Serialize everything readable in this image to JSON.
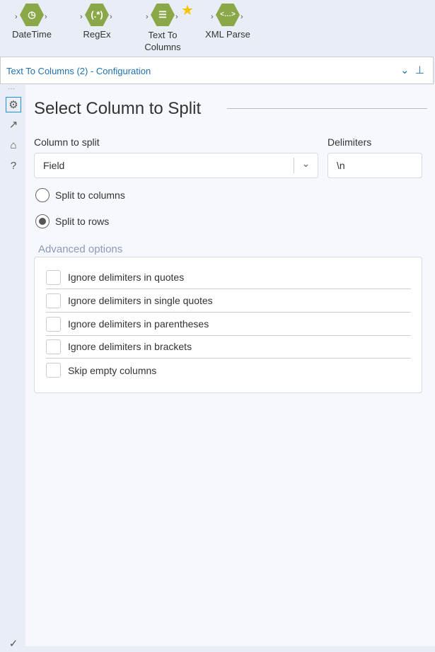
{
  "toolbar": {
    "tools": [
      {
        "label": "DateTime",
        "glyph": "◷"
      },
      {
        "label": "RegEx",
        "glyph": "(.*)"
      },
      {
        "label": "Text To Columns",
        "glyph": "☰"
      },
      {
        "label": "XML Parse",
        "glyph": "<…>"
      }
    ]
  },
  "header": {
    "title": "Text To Columns (2) - Configuration"
  },
  "main": {
    "title": "Select Column to Split",
    "column_label": "Column to split",
    "column_value": "Field",
    "delimiters_label": "Delimiters",
    "delimiters_value": "\\n",
    "radios": [
      "Split to columns",
      "Split to rows"
    ],
    "selected_radio": "Split to rows",
    "advanced_label": "Advanced options",
    "options": [
      "Ignore delimiters in quotes",
      "Ignore delimiters in single quotes",
      "Ignore delimiters in parentheses",
      "Ignore delimiters in brackets",
      "Skip empty columns"
    ]
  }
}
